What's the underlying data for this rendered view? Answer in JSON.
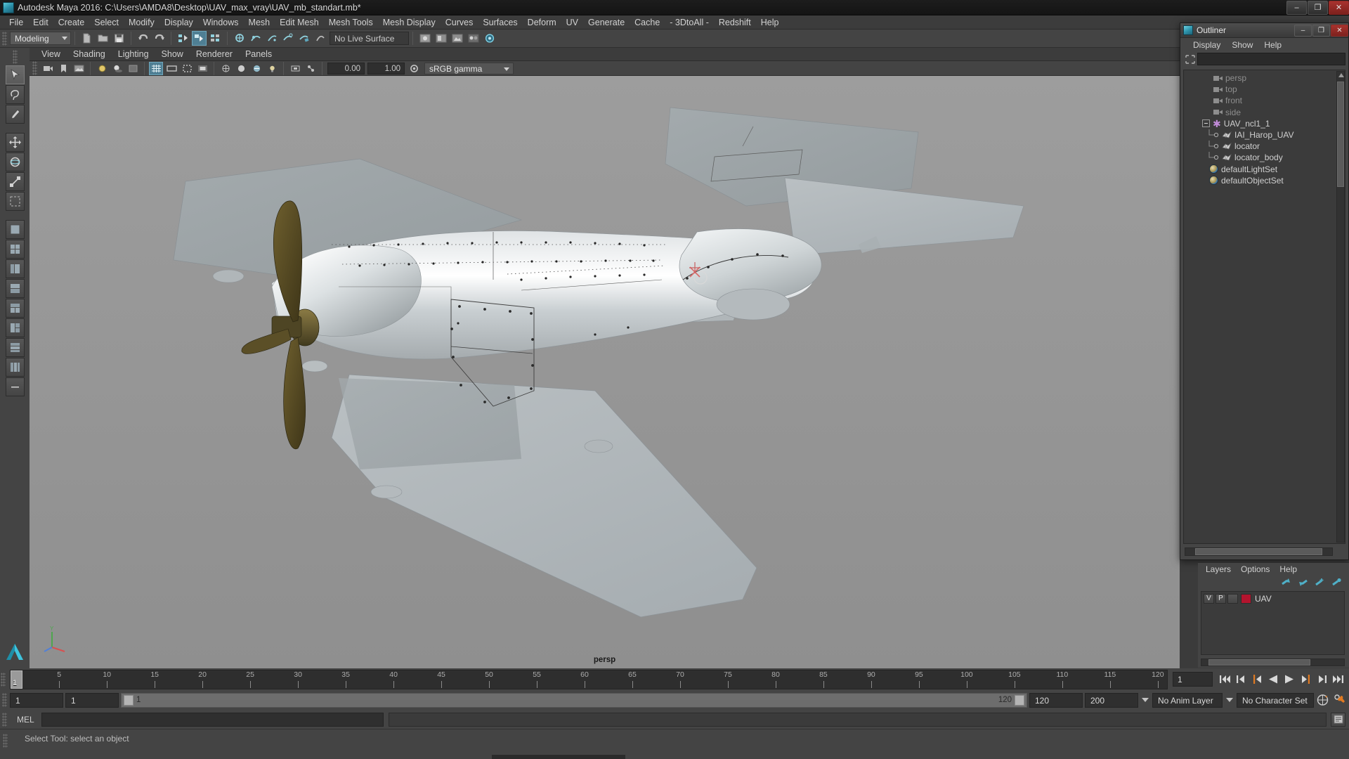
{
  "window": {
    "title": "Autodesk Maya 2016: C:\\Users\\AMDA8\\Desktop\\UAV_max_vray\\UAV_mb_standart.mb*",
    "app_icon": "maya-icon",
    "minimize_label": "–",
    "maximize_label": "❐",
    "close_label": "✕"
  },
  "menubar": {
    "items": [
      {
        "label": "File"
      },
      {
        "label": "Edit"
      },
      {
        "label": "Create"
      },
      {
        "label": "Select"
      },
      {
        "label": "Modify"
      },
      {
        "label": "Display"
      },
      {
        "label": "Windows"
      },
      {
        "label": "Mesh"
      },
      {
        "label": "Edit Mesh"
      },
      {
        "label": "Mesh Tools"
      },
      {
        "label": "Mesh Display"
      },
      {
        "label": "Curves"
      },
      {
        "label": "Surfaces"
      },
      {
        "label": "Deform"
      },
      {
        "label": "UV"
      },
      {
        "label": "Generate"
      },
      {
        "label": "Cache"
      },
      {
        "label": "- 3DtoAll -"
      },
      {
        "label": "Redshift"
      },
      {
        "label": "Help"
      }
    ]
  },
  "toolbar": {
    "mode_selected": "Modeling",
    "live_surface": "No Live Surface",
    "icons": [
      "new-scene-icon",
      "open-scene-icon",
      "save-scene-icon",
      "undo-icon",
      "redo-icon",
      "select-by-hierarchy-icon",
      "select-by-object-icon",
      "select-by-component-icon",
      "snap-to-grid-icon",
      "snap-to-curve-icon",
      "snap-to-point-icon",
      "snap-to-projected-center-icon",
      "snap-to-view-plane-icon",
      "make-live-icon",
      "render-current-frame-icon",
      "ipr-render-icon",
      "render-settings-icon",
      "hypershade-icon",
      "render-view-icon"
    ]
  },
  "viewport_panel": {
    "menus": [
      {
        "label": "View"
      },
      {
        "label": "Shading"
      },
      {
        "label": "Lighting"
      },
      {
        "label": "Show"
      },
      {
        "label": "Renderer"
      },
      {
        "label": "Panels"
      }
    ],
    "exposure_value": "0.00",
    "gamma_value": "1.00",
    "color_management": "sRGB gamma",
    "camera_label": "persp",
    "toolbar_icons": [
      "select-camera-icon",
      "bookmarks-icon",
      "image-plane-icon",
      "two-sided-lighting-icon",
      "shadows-icon",
      "xray-icon",
      "grid-icon",
      "film-gate-icon",
      "resolution-gate-icon",
      "gate-mask-icon",
      "wireframe-icon",
      "smooth-shade-icon",
      "textured-icon",
      "use-lights-icon",
      "isolate-select-icon",
      "xray-joints-icon",
      "exposure-icon",
      "gamma-icon"
    ]
  },
  "toolbox": {
    "tools": [
      {
        "name": "select-tool",
        "selected": true
      },
      {
        "name": "lasso-tool",
        "selected": false
      },
      {
        "name": "paint-select-tool",
        "selected": false
      },
      {
        "name": "move-tool",
        "selected": false
      },
      {
        "name": "rotate-tool",
        "selected": false
      },
      {
        "name": "scale-tool",
        "selected": false
      },
      {
        "name": "last-tool",
        "selected": false
      }
    ],
    "layout_buttons": [
      "single-perspective-layout",
      "four-view-layout",
      "outliner-persp-layout",
      "persp-graph-layout",
      "hypershade-persp-layout",
      "persp-uv-layout",
      "two-pane-layout",
      "three-pane-layout",
      "more-layouts"
    ]
  },
  "outliner": {
    "title": "Outliner",
    "icon": "outliner-icon",
    "minimize_label": "–",
    "maximize_label": "❐",
    "close_label": "✕",
    "menus": [
      {
        "label": "Display"
      },
      {
        "label": "Show"
      },
      {
        "label": "Help"
      }
    ],
    "search_value": "",
    "search_placeholder": "",
    "tree": [
      {
        "label": "persp",
        "icon": "camera-icon",
        "indent": 2,
        "dim": true,
        "type": "camera"
      },
      {
        "label": "top",
        "icon": "camera-icon",
        "indent": 2,
        "dim": true,
        "type": "camera"
      },
      {
        "label": "front",
        "icon": "camera-icon",
        "indent": 2,
        "dim": true,
        "type": "camera"
      },
      {
        "label": "side",
        "icon": "camera-icon",
        "indent": 2,
        "dim": true,
        "type": "camera"
      },
      {
        "label": "UAV_ncl1_1",
        "icon": "nucleus-icon",
        "indent": 0,
        "dim": false,
        "type": "group"
      },
      {
        "label": "IAI_Harop_UAV",
        "icon": "mesh-icon",
        "indent": 1,
        "dim": false,
        "type": "mesh"
      },
      {
        "label": "locator",
        "icon": "mesh-icon",
        "indent": 1,
        "dim": false,
        "type": "mesh"
      },
      {
        "label": "locator_body",
        "icon": "mesh-icon",
        "indent": 1,
        "dim": false,
        "type": "mesh"
      },
      {
        "label": "defaultLightSet",
        "icon": "set-icon",
        "indent": 0,
        "dim": false,
        "type": "set"
      },
      {
        "label": "defaultObjectSet",
        "icon": "set-icon",
        "indent": 0,
        "dim": false,
        "type": "set"
      }
    ]
  },
  "layer_editor": {
    "menus": [
      {
        "label": "Layers"
      },
      {
        "label": "Options"
      },
      {
        "label": "Help"
      }
    ],
    "icon_buttons": [
      "move-layer-up-icon",
      "move-layer-down-icon",
      "create-new-layer-icon",
      "create-layer-from-selected-icon"
    ],
    "layers": [
      {
        "visibility": "V",
        "playback": "P",
        "shading": "",
        "color": "#b3142e",
        "name": "UAV"
      }
    ]
  },
  "timeline": {
    "ticks": [
      5,
      10,
      15,
      20,
      25,
      30,
      35,
      40,
      45,
      50,
      55,
      60,
      65,
      70,
      75,
      80,
      85,
      90,
      95,
      100,
      105,
      110,
      115,
      120
    ],
    "range_start": 1,
    "range_end": 120,
    "current_frame": "1",
    "current_frame_field": "1",
    "playback_buttons": [
      "go-to-start-icon",
      "step-back-frame-icon",
      "step-back-key-icon",
      "play-backwards-icon",
      "play-forwards-icon",
      "step-forward-key-icon",
      "step-forward-frame-icon",
      "go-to-end-icon"
    ]
  },
  "range_slider": {
    "anim_start": "1",
    "range_start": "1",
    "bar_start_label": "1",
    "bar_end_label": "120",
    "range_end": "120",
    "anim_end": "200",
    "anim_layer": "No Anim Layer",
    "character_set": "No Character Set",
    "icons": [
      "auto-key-icon",
      "animation-preferences-icon"
    ]
  },
  "command_line": {
    "language_label": "MEL",
    "input_value": "",
    "output_value": "",
    "script_editor_icon": "script-editor-icon"
  },
  "help_line": {
    "text": "Select Tool: select an object"
  },
  "colors": {
    "accent_teal": "#4f9fb8",
    "highlight_orange": "#e07a22",
    "layer_red": "#b3142e",
    "panel_bg": "#444444",
    "viewport_bg": "#959595"
  }
}
